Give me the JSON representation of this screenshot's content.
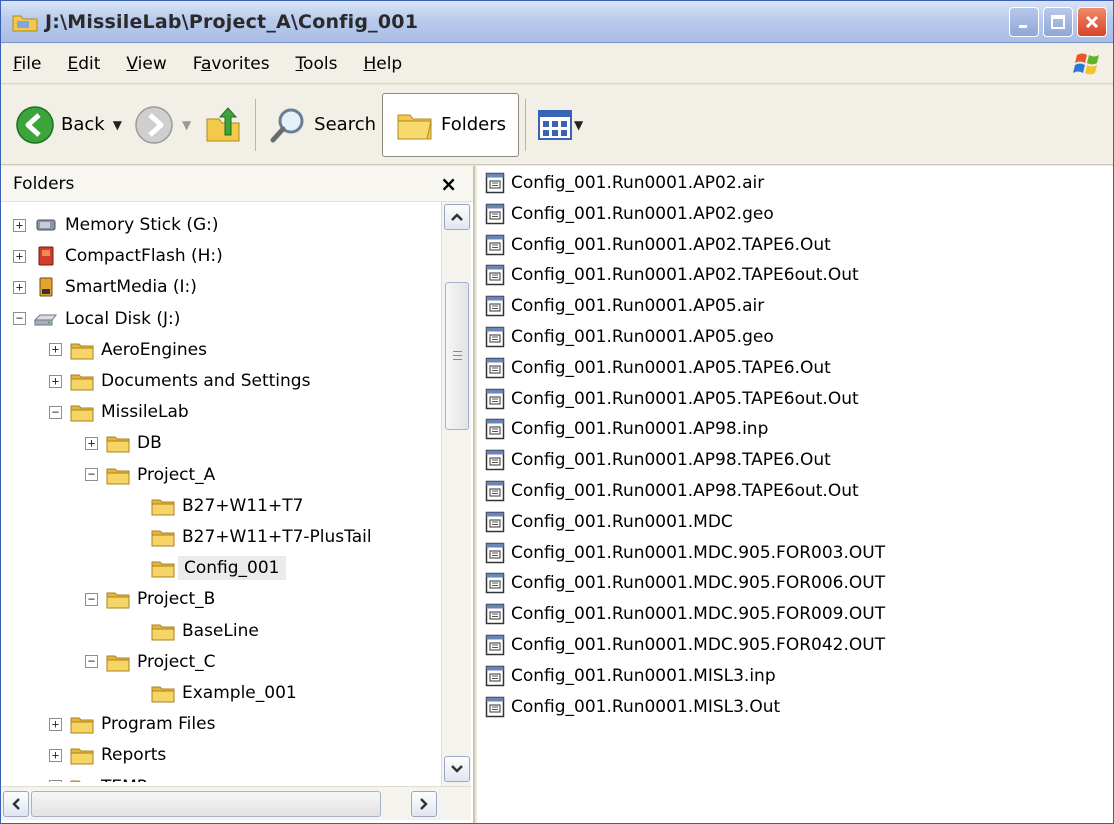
{
  "window": {
    "title": "J:\\MissileLab\\Project_A\\Config_001"
  },
  "menu": [
    {
      "label": "File",
      "key": "F",
      "rest": "ile"
    },
    {
      "label": "Edit",
      "key": "E",
      "rest": "dit"
    },
    {
      "label": "View",
      "key": "V",
      "rest": "iew"
    },
    {
      "label": "Favorites",
      "key": "a",
      "pre": "F",
      "rest": "vorites"
    },
    {
      "label": "Tools",
      "key": "T",
      "rest": "ools"
    },
    {
      "label": "Help",
      "key": "H",
      "rest": "elp"
    }
  ],
  "toolbar": {
    "back_label": "Back",
    "search_label": "Search",
    "folders_label": "Folders"
  },
  "folders_pane": {
    "header": "Folders",
    "close_glyph": "×"
  },
  "tree": [
    {
      "label": "Memory Stick (G:)",
      "level": 1,
      "expander": "+",
      "icon": "memory-stick-icon"
    },
    {
      "label": "CompactFlash (H:)",
      "level": 1,
      "expander": "+",
      "icon": "compactflash-icon"
    },
    {
      "label": "SmartMedia (I:)",
      "level": 1,
      "expander": "+",
      "icon": "smartmedia-icon"
    },
    {
      "label": "Local Disk (J:)",
      "level": 1,
      "expander": "-",
      "icon": "local-disk-icon"
    },
    {
      "label": "AeroEngines",
      "level": 2,
      "expander": "+",
      "icon": "folder-icon"
    },
    {
      "label": "Documents and Settings",
      "level": 2,
      "expander": "+",
      "icon": "folder-icon"
    },
    {
      "label": "MissileLab",
      "level": 2,
      "expander": "-",
      "icon": "folder-icon"
    },
    {
      "label": "DB",
      "level": 3,
      "expander": "+",
      "icon": "folder-icon"
    },
    {
      "label": "Project_A",
      "level": 3,
      "expander": "-",
      "icon": "folder-icon"
    },
    {
      "label": "B27+W11+T7",
      "level": 4,
      "expander": "",
      "icon": "folder-icon"
    },
    {
      "label": "B27+W11+T7-PlusTail",
      "level": 4,
      "expander": "",
      "icon": "folder-icon"
    },
    {
      "label": "Config_001",
      "level": 4,
      "expander": "",
      "icon": "folder-icon",
      "selected": true
    },
    {
      "label": "Project_B",
      "level": 3,
      "expander": "-",
      "icon": "folder-icon"
    },
    {
      "label": "BaseLine",
      "level": 4,
      "expander": "",
      "icon": "folder-icon"
    },
    {
      "label": "Project_C",
      "level": 3,
      "expander": "-",
      "icon": "folder-icon"
    },
    {
      "label": "Example_001",
      "level": 4,
      "expander": "",
      "icon": "folder-icon"
    },
    {
      "label": "Program Files",
      "level": 2,
      "expander": "+",
      "icon": "folder-icon"
    },
    {
      "label": "Reports",
      "level": 2,
      "expander": "+",
      "icon": "folder-icon"
    },
    {
      "label": "TEMP",
      "level": 2,
      "expander": "+",
      "icon": "folder-icon"
    }
  ],
  "files": [
    "Config_001.Run0001.AP02.air",
    "Config_001.Run0001.AP02.geo",
    "Config_001.Run0001.AP02.TAPE6.Out",
    "Config_001.Run0001.AP02.TAPE6out.Out",
    "Config_001.Run0001.AP05.air",
    "Config_001.Run0001.AP05.geo",
    "Config_001.Run0001.AP05.TAPE6.Out",
    "Config_001.Run0001.AP05.TAPE6out.Out",
    "Config_001.Run0001.AP98.inp",
    "Config_001.Run0001.AP98.TAPE6.Out",
    "Config_001.Run0001.AP98.TAPE6out.Out",
    "Config_001.Run0001.MDC",
    "Config_001.Run0001.MDC.905.FOR003.OUT",
    "Config_001.Run0001.MDC.905.FOR006.OUT",
    "Config_001.Run0001.MDC.905.FOR009.OUT",
    "Config_001.Run0001.MDC.905.FOR042.OUT",
    "Config_001.Run0001.MISL3.inp",
    "Config_001.Run0001.MISL3.Out"
  ],
  "colors": {
    "titlebar": "#b9cbec",
    "folder": "#f3c94a",
    "back_button": "#3ba53b"
  }
}
